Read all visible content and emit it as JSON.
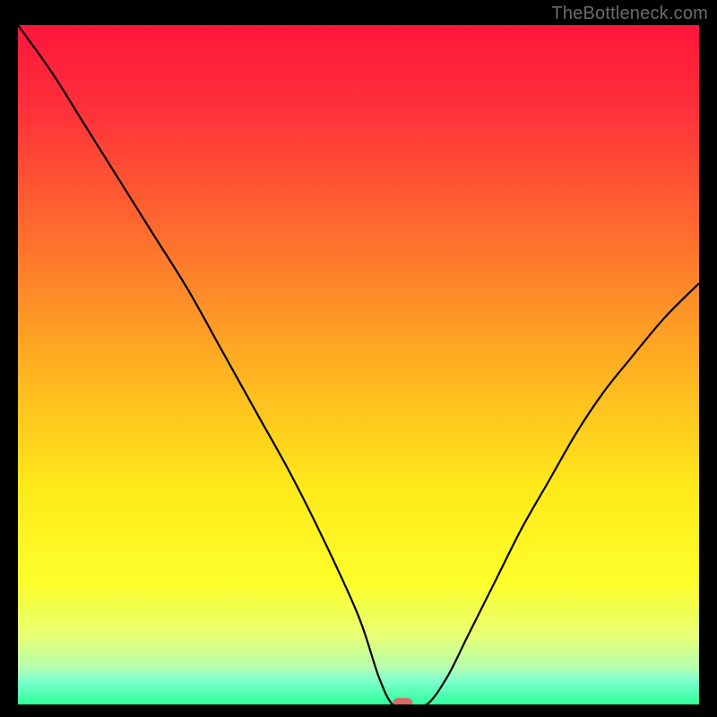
{
  "watermark": "TheBottleneck.com",
  "chart_data": {
    "type": "line",
    "title": "",
    "xlabel": "",
    "ylabel": "",
    "xlim": [
      0,
      100
    ],
    "ylim": [
      0,
      100
    ],
    "legend": false,
    "grid": false,
    "background": "vertical-gradient",
    "gradient_stops": [
      {
        "pos": 0.0,
        "color": "#ff163b"
      },
      {
        "pos": 0.12,
        "color": "#ff2f3a"
      },
      {
        "pos": 0.3,
        "color": "#ff6a2f"
      },
      {
        "pos": 0.5,
        "color": "#ffb021"
      },
      {
        "pos": 0.68,
        "color": "#ffe91a"
      },
      {
        "pos": 0.82,
        "color": "#fdff2a"
      },
      {
        "pos": 0.9,
        "color": "#e6ff75"
      },
      {
        "pos": 0.945,
        "color": "#b7ffb0"
      },
      {
        "pos": 0.965,
        "color": "#7dffcd"
      },
      {
        "pos": 1.0,
        "color": "#2eff9a"
      }
    ],
    "series": [
      {
        "name": "bottleneck-curve",
        "x": [
          0,
          5,
          10,
          15,
          20,
          25,
          30,
          35,
          40,
          45,
          50,
          53,
          55,
          57,
          60,
          63,
          66,
          70,
          74,
          78,
          82,
          86,
          90,
          95,
          100
        ],
        "y": [
          100,
          93,
          85,
          77,
          69,
          61,
          52,
          43,
          34,
          24,
          13,
          4,
          0,
          0,
          0,
          4,
          10,
          18,
          26,
          33,
          40,
          46,
          51,
          57,
          62
        ]
      }
    ],
    "marker": {
      "x": 56.5,
      "y": 0,
      "shape": "pill",
      "color": "#d46a6a"
    }
  },
  "colors": {
    "frame": "#000000",
    "curve": "#000000",
    "marker": "#d46a6a",
    "watermark": "#6b6b6b"
  }
}
